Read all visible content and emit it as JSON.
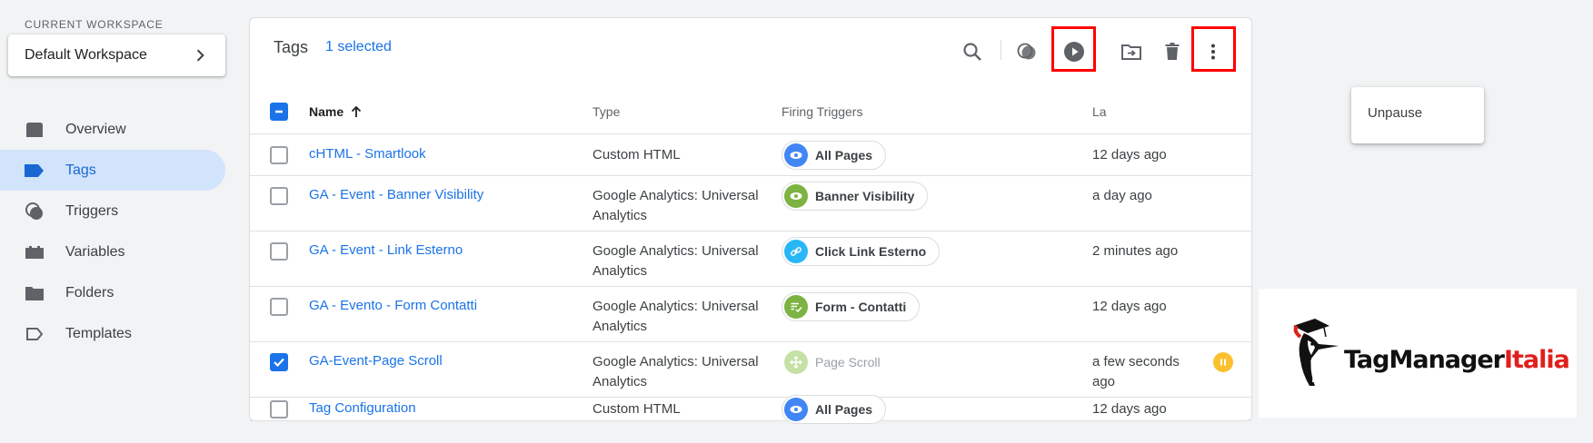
{
  "sidebar": {
    "workspace_label": "CURRENT WORKSPACE",
    "workspace_name": "Default Workspace",
    "items": [
      {
        "label": "Overview",
        "icon": "overview-icon"
      },
      {
        "label": "Tags",
        "icon": "tag-icon"
      },
      {
        "label": "Triggers",
        "icon": "trigger-icon"
      },
      {
        "label": "Variables",
        "icon": "variables-icon"
      },
      {
        "label": "Folders",
        "icon": "folder-icon"
      },
      {
        "label": "Templates",
        "icon": "template-icon"
      }
    ],
    "active": "Tags"
  },
  "panel": {
    "title": "Tags",
    "selection": "1 selected",
    "toolbar": [
      "search-icon",
      "trigger-overlap-icon",
      "play-icon",
      "move-to-folder-icon",
      "delete-icon",
      "more-vert-icon"
    ],
    "headers": {
      "name": "Name",
      "type": "Type",
      "triggers": "Firing Triggers",
      "last_edited": "La"
    },
    "rows": [
      {
        "name": "cHTML - Smartlook",
        "type": "Custom HTML",
        "trigger": "All Pages",
        "trigger_icon": "eye-icon",
        "trigger_color": "#4285f4",
        "edited": "12 days ago",
        "checked": false
      },
      {
        "name": "GA - Event - Banner Visibility",
        "type": "Google Analytics: Universal Analytics",
        "trigger": "Banner Visibility",
        "trigger_icon": "eye-icon",
        "trigger_color": "#7cb342",
        "edited": "a day ago",
        "checked": false
      },
      {
        "name": "GA - Event - Link Esterno",
        "type": "Google Analytics: Universal Analytics",
        "trigger": "Click Link Esterno",
        "trigger_icon": "link-icon",
        "trigger_color": "#29b6f6",
        "edited": "2 minutes ago",
        "checked": false
      },
      {
        "name": "GA - Evento - Form Contatti",
        "type": "Google Analytics: Universal Analytics",
        "trigger": "Form - Contatti",
        "trigger_icon": "form-icon",
        "trigger_color": "#7cb342",
        "edited": "12 days ago",
        "checked": false
      },
      {
        "name": "GA-Event-Page Scroll",
        "type": "Google Analytics: Universal Analytics",
        "trigger": "Page Scroll",
        "trigger_icon": "scroll-icon",
        "trigger_color": "#c5e1a5",
        "edited": "a few seconds ago",
        "checked": true,
        "paused": true
      },
      {
        "name": "Tag Configuration",
        "type": "Custom HTML",
        "trigger": "All Pages",
        "trigger_icon": "eye-icon",
        "trigger_color": "#4285f4",
        "edited": "12 days ago",
        "checked": false
      }
    ]
  },
  "menu": {
    "item": "Unpause"
  },
  "logo": {
    "text_dark": "TagManager",
    "text_red": "Italia"
  },
  "colors": {
    "accent": "#1a73e8",
    "highlight": "#ff0000",
    "paused": "#fbc02d",
    "brand_red": "#e0201c"
  }
}
